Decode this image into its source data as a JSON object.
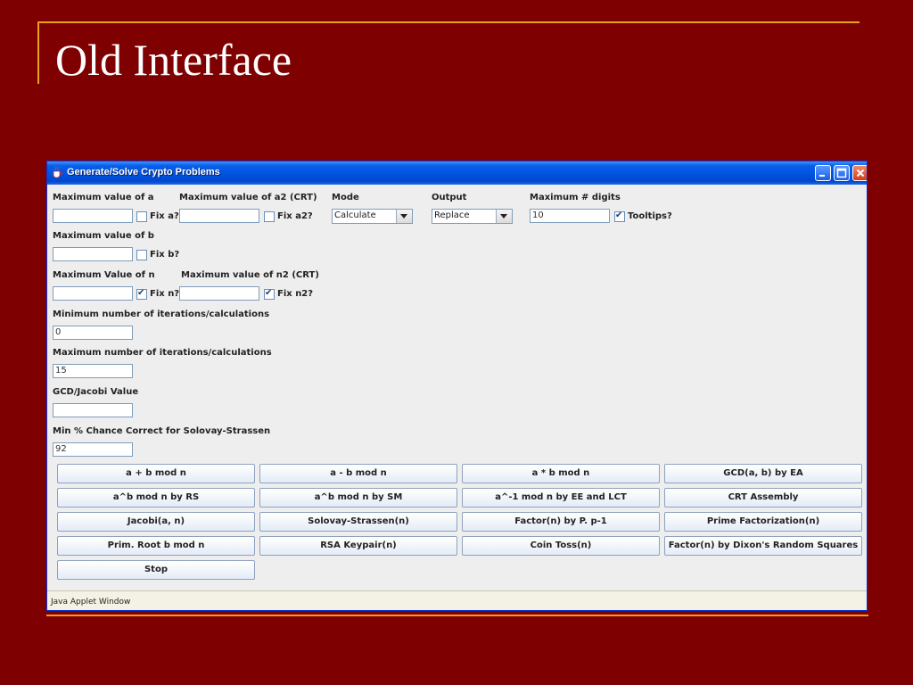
{
  "slide": {
    "title": "Old Interface"
  },
  "window": {
    "title": "Generate/Solve Crypto Problems",
    "status_text": "Java Applet Window"
  },
  "form": {
    "max_a_label": "Maximum value of a",
    "max_a_value": "",
    "fix_a_label": "Fix a?",
    "fix_a_checked": false,
    "max_a2_label": "Maximum value of a2 (CRT)",
    "max_a2_value": "",
    "fix_a2_label": "Fix a2?",
    "fix_a2_checked": false,
    "mode_label": "Mode",
    "mode_value": "Calculate",
    "output_label": "Output",
    "output_value": "Replace",
    "max_digits_label": "Maximum # digits",
    "max_digits_value": "10",
    "tooltips_label": "Tooltips?",
    "tooltips_checked": true,
    "max_b_label": "Maximum value of b",
    "max_b_value": "",
    "fix_b_label": "Fix b?",
    "fix_b_checked": false,
    "max_n_label": "Maximum Value of n",
    "max_n_value": "",
    "fix_n_label": "Fix n?",
    "fix_n_checked": true,
    "max_n2_label": "Maximum value of n2 (CRT)",
    "max_n2_value": "",
    "fix_n2_label": "Fix n2?",
    "fix_n2_checked": true,
    "min_iter_label": "Minimum number of iterations/calculations",
    "min_iter_value": "0",
    "max_iter_label": "Maximum number of iterations/calculations",
    "max_iter_value": "15",
    "gcd_label": "GCD/Jacobi Value",
    "gcd_value": "",
    "solovay_label": "Min % Chance Correct for Solovay-Strassen",
    "solovay_value": "92"
  },
  "buttons": [
    "a + b mod n",
    "a - b mod n",
    "a * b mod n",
    "GCD(a, b) by EA",
    "a^b mod n by RS",
    "a^b mod n by SM",
    "a^-1 mod n by EE and LCT",
    "CRT Assembly",
    "Jacobi(a, n)",
    "Solovay-Strassen(n)",
    "Factor(n) by P. p-1",
    "Prime Factorization(n)",
    "Prim. Root b mod n",
    "RSA Keypair(n)",
    "Coin Toss(n)",
    "Factor(n) by Dixon's Random Squares",
    "Stop"
  ],
  "colors": {
    "slide_background": "#7f0000",
    "accent_line": "#e8a21a",
    "titlebar_blue": "#0054e3"
  }
}
